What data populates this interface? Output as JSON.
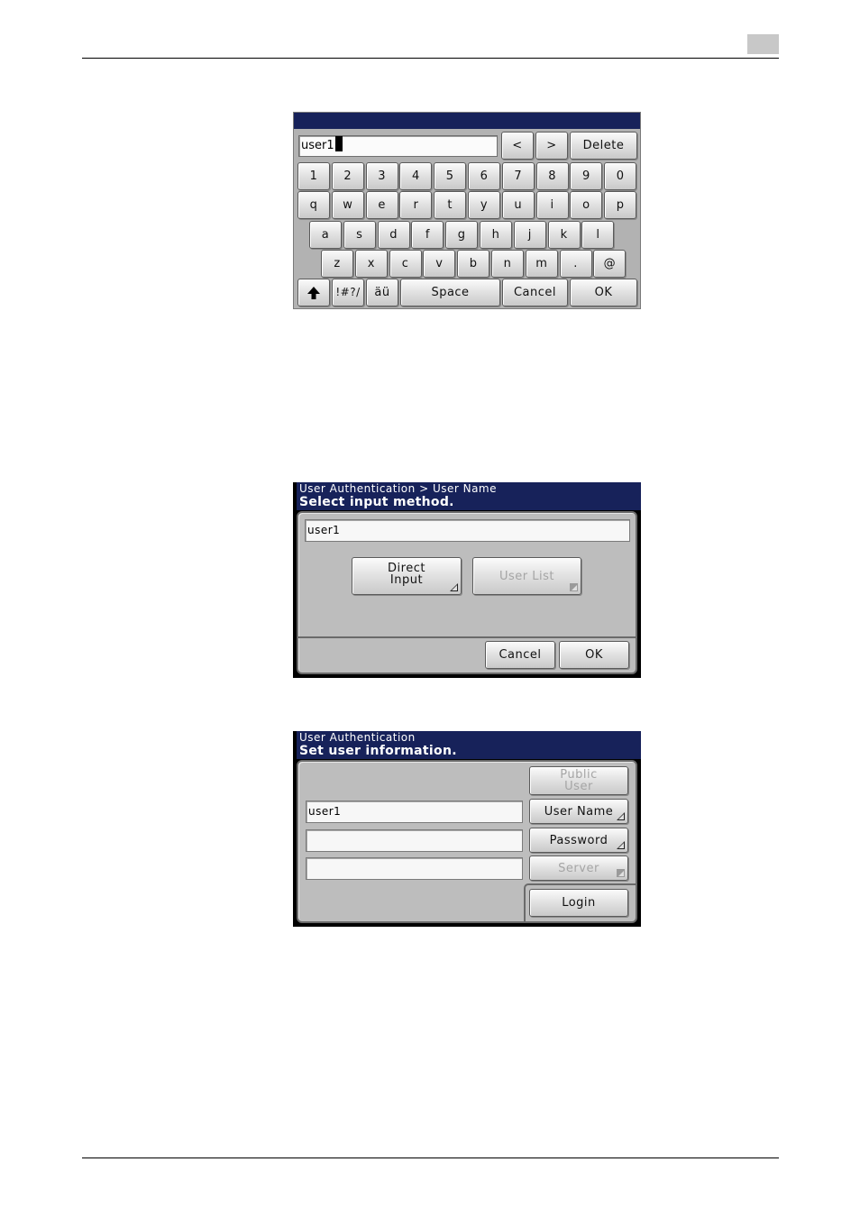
{
  "page": {
    "header_box_text": ""
  },
  "keyboard": {
    "input_value": "user1",
    "top_keys": [
      "<",
      ">",
      "Delete"
    ],
    "row_numbers": [
      "1",
      "2",
      "3",
      "4",
      "5",
      "6",
      "7",
      "8",
      "9",
      "0"
    ],
    "row_qwerty": [
      "q",
      "w",
      "e",
      "r",
      "t",
      "y",
      "u",
      "i",
      "o",
      "p"
    ],
    "row_home": [
      "a",
      "s",
      "d",
      "f",
      "g",
      "h",
      "j",
      "k",
      "l"
    ],
    "row_bottom": [
      "z",
      "x",
      "c",
      "v",
      "b",
      "n",
      "m",
      ".",
      "@"
    ],
    "bottom_bar": {
      "shift_icon": "up-arrow-icon",
      "symbols": "!#?/",
      "accents": "äü",
      "space": "Space",
      "cancel": "Cancel",
      "ok": "OK"
    }
  },
  "select_dialog": {
    "breadcrumb": "User Authentication > User Name",
    "title": "Select input method.",
    "input_value": "user1",
    "direct_input_line1": "Direct",
    "direct_input_line2": "Input",
    "user_list": "User List",
    "cancel": "Cancel",
    "ok": "OK"
  },
  "auth_dialog": {
    "breadcrumb": "User Authentication",
    "title": "Set user information.",
    "user_name_value": "user1",
    "password_value": "",
    "server_value": "",
    "public_user_line1": "Public",
    "public_user_line2": "User",
    "user_name_button": "User Name",
    "password_button": "Password",
    "server_button": "Server",
    "login_button": "Login"
  }
}
